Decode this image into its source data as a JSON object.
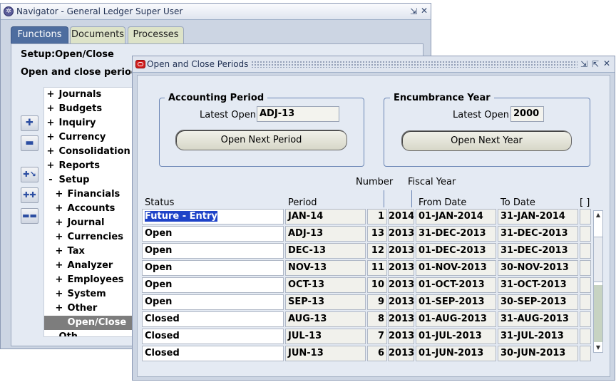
{
  "navigator": {
    "title": "Navigator - General Ledger Super User",
    "app_icon": "oracle-apps-icon",
    "tabs": [
      "Functions",
      "Documents",
      "Processes"
    ],
    "active_tab": "Functions",
    "path": "Setup:Open/Close",
    "function_title": "Open and close periods",
    "toolbar_icons": [
      "expand-plus-icon",
      "collapse-minus-icon",
      "expand-branch-icon",
      "expand-all-icon",
      "collapse-all-icon"
    ],
    "tree": [
      {
        "sym": "+",
        "label": "Journals",
        "indent": 0
      },
      {
        "sym": "+",
        "label": "Budgets",
        "indent": 0
      },
      {
        "sym": "+",
        "label": "Inquiry",
        "indent": 0
      },
      {
        "sym": "+",
        "label": "Currency",
        "indent": 0
      },
      {
        "sym": "+",
        "label": "Consolidation",
        "indent": 0
      },
      {
        "sym": "+",
        "label": "Reports",
        "indent": 0
      },
      {
        "sym": "-",
        "label": "Setup",
        "indent": 0
      },
      {
        "sym": "+",
        "label": "Financials",
        "indent": 1
      },
      {
        "sym": "+",
        "label": "Accounts",
        "indent": 1
      },
      {
        "sym": "+",
        "label": "Journal",
        "indent": 1
      },
      {
        "sym": "+",
        "label": "Currencies",
        "indent": 1
      },
      {
        "sym": "+",
        "label": "Tax",
        "indent": 1
      },
      {
        "sym": "+",
        "label": "Analyzer",
        "indent": 1
      },
      {
        "sym": "+",
        "label": "Employees",
        "indent": 1
      },
      {
        "sym": "+",
        "label": "System",
        "indent": 1
      },
      {
        "sym": "+",
        "label": "Other",
        "indent": 1
      },
      {
        "sym": "",
        "label": "Open/Close",
        "indent": 1,
        "selected": true
      },
      {
        "sym": "",
        "label": "Oth",
        "indent": 0
      }
    ]
  },
  "periods_window": {
    "title": "Open and Close Periods",
    "accounting_period": {
      "title": "Accounting Period",
      "latest_open_label": "Latest Open",
      "latest_open_value": "ADJ-13",
      "button_label": "Open Next Period"
    },
    "encumbrance_year": {
      "title": "Encumbrance Year",
      "latest_open_label": "Latest Open",
      "latest_open_value": "2000",
      "button_label": "Open Next Year"
    },
    "columns": {
      "status": "Status",
      "period": "Period",
      "number": "Number",
      "fiscal_year": "Fiscal Year",
      "from_date": "From Date",
      "to_date": "To Date",
      "dff": "[ ]"
    },
    "rows": [
      {
        "status": "Future - Entry",
        "period": "JAN-14",
        "number": "1",
        "year": "2014",
        "from": "01-JAN-2014",
        "to": "31-JAN-2014"
      },
      {
        "status": "Open",
        "period": "ADJ-13",
        "number": "13",
        "year": "2013",
        "from": "31-DEC-2013",
        "to": "31-DEC-2013"
      },
      {
        "status": "Open",
        "period": "DEC-13",
        "number": "12",
        "year": "2013",
        "from": "01-DEC-2013",
        "to": "31-DEC-2013"
      },
      {
        "status": "Open",
        "period": "NOV-13",
        "number": "11",
        "year": "2013",
        "from": "01-NOV-2013",
        "to": "30-NOV-2013"
      },
      {
        "status": "Open",
        "period": "OCT-13",
        "number": "10",
        "year": "2013",
        "from": "01-OCT-2013",
        "to": "31-OCT-2013"
      },
      {
        "status": "Open",
        "period": "SEP-13",
        "number": "9",
        "year": "2013",
        "from": "01-SEP-2013",
        "to": "30-SEP-2013"
      },
      {
        "status": "Closed",
        "period": "AUG-13",
        "number": "8",
        "year": "2013",
        "from": "01-AUG-2013",
        "to": "31-AUG-2013"
      },
      {
        "status": "Closed",
        "period": "JUL-13",
        "number": "7",
        "year": "2013",
        "from": "01-JUL-2013",
        "to": "31-JUL-2013"
      },
      {
        "status": "Closed",
        "period": "JUN-13",
        "number": "6",
        "year": "2013",
        "from": "01-JUN-2013",
        "to": "30-JUN-2013"
      }
    ]
  }
}
